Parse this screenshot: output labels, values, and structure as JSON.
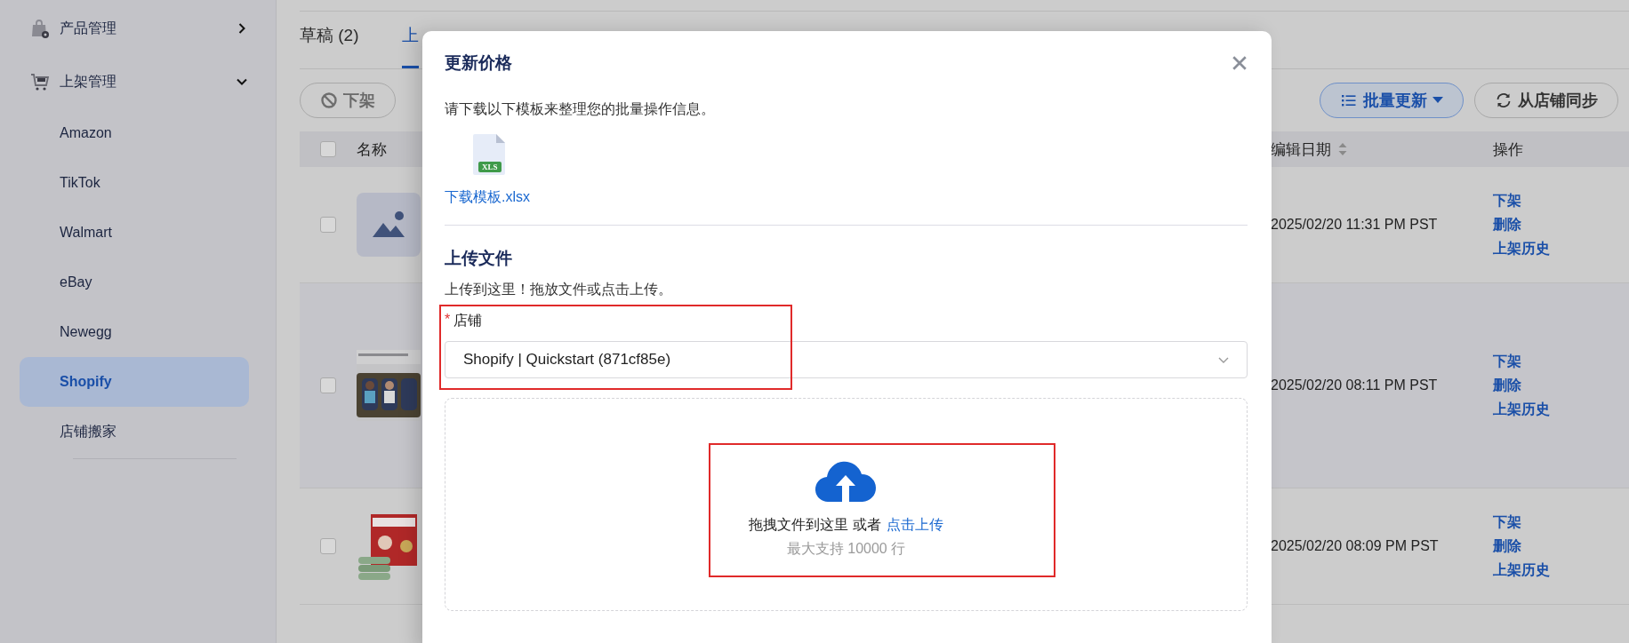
{
  "sidebar": {
    "items": [
      {
        "label": "产品管理",
        "expanded": false
      },
      {
        "label": "上架管理",
        "expanded": true,
        "children": [
          {
            "label": "Amazon",
            "selected": false
          },
          {
            "label": "TikTok",
            "selected": false
          },
          {
            "label": "Walmart",
            "selected": false
          },
          {
            "label": "eBay",
            "selected": false
          },
          {
            "label": "Newegg",
            "selected": false
          },
          {
            "label": "Shopify",
            "selected": true
          },
          {
            "label": "店铺搬家",
            "selected": false
          }
        ]
      }
    ]
  },
  "tabs": [
    {
      "label": "草稿 (2)",
      "selected": false
    },
    {
      "label": "上",
      "selected": true
    }
  ],
  "toolbar": {
    "left_buttons": [
      {
        "label": "下架"
      }
    ],
    "right_buttons": [
      {
        "label": "批量更新",
        "kind": "primary"
      },
      {
        "label": "从店铺同步",
        "kind": "default"
      }
    ]
  },
  "table": {
    "header_checked": false,
    "columns": [
      {
        "label": "名称",
        "sortable": false
      },
      {
        "label": "编辑日期",
        "sortable": true
      },
      {
        "label": "操作",
        "sortable": false
      }
    ],
    "rows": [
      {
        "checked": false,
        "kind": "placeholder",
        "date": "2025/02/20 11:31 PM PST",
        "actions": [
          "下架",
          "删除",
          "上架历史"
        ],
        "highlighted": false
      },
      {
        "checked": false,
        "kind": "picture",
        "date": "2025/02/20 08:11 PM PST",
        "actions": [
          "下架",
          "删除",
          "上架历史"
        ],
        "highlighted": true
      },
      {
        "checked": false,
        "kind": "picture",
        "date": "2025/02/20 08:09 PM PST",
        "actions": [
          "下架",
          "删除",
          "上架历史"
        ],
        "highlighted": false
      }
    ]
  },
  "modal": {
    "title": "更新价格",
    "instruction": "请下载以下模板来整理您的批量操作信息。",
    "file_badge": "XLS",
    "template_link": "下载模板.xlsx",
    "section_title": "上传文件",
    "hint": "上传到这里！拖放文件或点击上传。",
    "store_field": {
      "label": "店铺",
      "required_mark": "*",
      "value": "Shopify | Quickstart (871cf85e)",
      "annotated": true
    },
    "dropzone": {
      "text": "拖拽文件到这里 或者",
      "link": "点击上传",
      "limit": "最大支持 10000 行",
      "annotated": true
    }
  }
}
